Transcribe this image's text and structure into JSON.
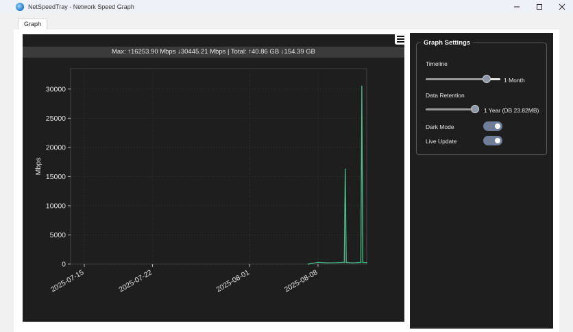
{
  "window": {
    "title": "NetSpeedTray - Network Speed Graph"
  },
  "tabs": [
    {
      "label": "Graph"
    }
  ],
  "stats": {
    "text": "Max: ↑16253.90 Mbps ↓30445.21 Mbps | Total: ↑40.86 GB ↓154.39 GB"
  },
  "settings": {
    "title": "Graph Settings",
    "timeline": {
      "label": "Timeline",
      "value_text": "1 Month"
    },
    "retention": {
      "label": "Data Retention",
      "value_text": "1 Year (DB 23.82MB)"
    },
    "dark_mode": {
      "label": "Dark Mode",
      "on": true
    },
    "live_update": {
      "label": "Live Update",
      "on": true
    }
  },
  "icons": {
    "menu": "hamburger-icon",
    "minimize": "minimize-icon",
    "maximize": "maximize-icon",
    "close": "close-icon"
  },
  "colors": {
    "line": "#4fc08d",
    "panel_bg": "#1e1e1e"
  },
  "chart_data": {
    "type": "line",
    "title": "",
    "xlabel": "",
    "ylabel": "Mbps",
    "ylim": [
      0,
      33500
    ],
    "yticks": [
      0,
      5000,
      10000,
      15000,
      20000,
      25000,
      30000
    ],
    "xtick_labels": [
      "2025-07-15",
      "2025-07-22",
      "2025-08-01",
      "2025-08-08"
    ],
    "xtick_days": [
      0,
      7,
      17,
      24
    ],
    "xlim_days": [
      0,
      29
    ],
    "grid": true,
    "series": [
      {
        "x_days": [
          23.0,
          24.0,
          25.0,
          26.0,
          26.7,
          26.8,
          26.9,
          27.5,
          28.0,
          28.4,
          28.5,
          28.6,
          29.0
        ],
        "values": [
          0,
          300,
          200,
          250,
          300,
          16253.9,
          300,
          200,
          250,
          300,
          30445.21,
          300,
          250
        ]
      }
    ]
  }
}
